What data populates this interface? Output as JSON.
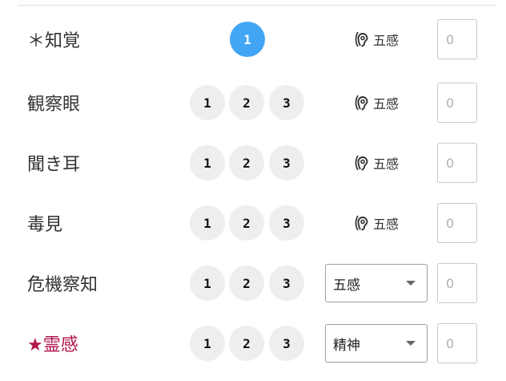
{
  "rows": [
    {
      "label": "＊知覚",
      "levels": [
        "1"
      ],
      "active_level": "1",
      "sense": "五感",
      "value_placeholder": "0"
    },
    {
      "label": "観察眼",
      "levels": [
        "1",
        "2",
        "3"
      ],
      "sense": "五感",
      "value_placeholder": "0"
    },
    {
      "label": "聞き耳",
      "levels": [
        "1",
        "2",
        "3"
      ],
      "sense": "五感",
      "value_placeholder": "0"
    },
    {
      "label": "毒見",
      "levels": [
        "1",
        "2",
        "3"
      ],
      "sense": "五感",
      "value_placeholder": "0"
    },
    {
      "label": "危機察知",
      "levels": [
        "1",
        "2",
        "3"
      ],
      "select_value": "五感",
      "value_placeholder": "0"
    },
    {
      "label": "★霊感",
      "levels": [
        "1",
        "2",
        "3"
      ],
      "select_value": "精神",
      "value_placeholder": "0"
    }
  ],
  "colors": {
    "active_level": "#42a5f5",
    "special_label": "#b0124c",
    "level_bg": "#eeeeee"
  },
  "icons": {
    "sense": "ear-icon",
    "dropdown": "chevron-down-icon"
  }
}
